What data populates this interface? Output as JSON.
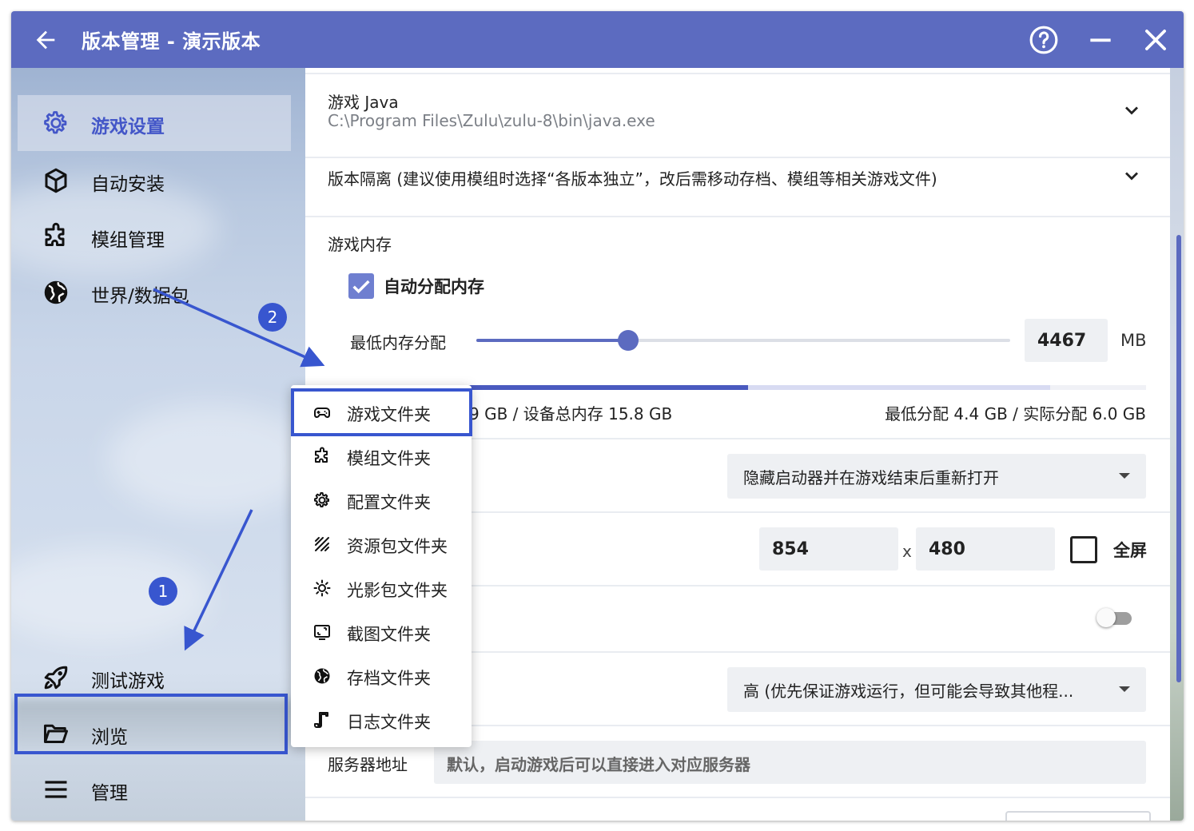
{
  "window": {
    "title": "版本管理 - 演示版本",
    "accent_color": "#5c6bc0",
    "highlight_color": "#3856cf"
  },
  "sidebar": {
    "items": [
      {
        "label": "游戏设置",
        "icon": "gear-icon",
        "active": true
      },
      {
        "label": "自动安装",
        "icon": "cube-icon"
      },
      {
        "label": "模组管理",
        "icon": "puzzle-icon"
      },
      {
        "label": "世界/数据包",
        "icon": "globe-icon"
      },
      {
        "label": "测试游戏",
        "icon": "rocket-icon"
      },
      {
        "label": "浏览",
        "icon": "folder-open-icon",
        "highlighted": true
      },
      {
        "label": "管理",
        "icon": "menu-icon"
      }
    ]
  },
  "main": {
    "java": {
      "title": "游戏 Java",
      "value": "C:\\Program Files\\Zulu\\zulu-8\\bin\\java.exe"
    },
    "isolation": {
      "title": "版本隔离 (建议使用模组时选择“各版本独立”，改后需移动存档、模组等相关游戏文件)"
    },
    "memory": {
      "section_title": "游戏内存",
      "auto_label": "自动分配内存",
      "auto_checked": true,
      "min_label": "最低内存分配",
      "min_value": "4467",
      "unit": "MB",
      "slider_fraction": 0.285,
      "bar_used_fraction": 0.5,
      "bar_allocated_fraction": 0.88,
      "usage_text": "9 GB / 设备总内存 15.8 GB",
      "alloc_text": "最低分配 4.4 GB / 实际分配 6.0 GB"
    },
    "launcher_visibility": {
      "value": "隐藏启动器并在游戏结束后重新打开"
    },
    "resolution": {
      "width": "854",
      "separator": "x",
      "height": "480",
      "fullscreen_label": "全屏",
      "fullscreen_checked": false
    },
    "toggle": {
      "on": false
    },
    "priority": {
      "value": "高 (优先保证游戏运行，但可能会导致其他程..."
    },
    "server": {
      "label": "服务器地址",
      "placeholder": "默认，启动游戏后可以直接进入对应服务器"
    }
  },
  "popup_menu": {
    "items": [
      {
        "label": "游戏文件夹",
        "icon": "gamepad-icon",
        "highlighted": true
      },
      {
        "label": "模组文件夹",
        "icon": "puzzle-icon"
      },
      {
        "label": "配置文件夹",
        "icon": "gear-icon"
      },
      {
        "label": "资源包文件夹",
        "icon": "texture-icon"
      },
      {
        "label": "光影包文件夹",
        "icon": "sun-icon"
      },
      {
        "label": "截图文件夹",
        "icon": "screenshot-icon"
      },
      {
        "label": "存档文件夹",
        "icon": "globe-icon"
      },
      {
        "label": "日志文件夹",
        "icon": "log-icon"
      }
    ]
  },
  "annotations": {
    "step1": "1",
    "step2": "2"
  }
}
